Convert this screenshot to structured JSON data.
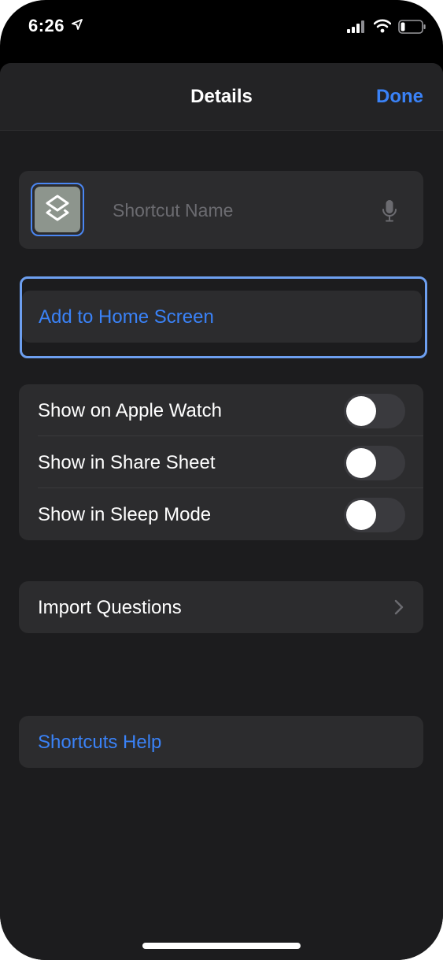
{
  "status_bar": {
    "time": "6:26"
  },
  "nav": {
    "title": "Details",
    "done_label": "Done"
  },
  "name_field": {
    "placeholder": "Shortcut Name",
    "value": ""
  },
  "add_to_home": {
    "label": "Add to Home Screen"
  },
  "toggles": [
    {
      "label": "Show on Apple Watch",
      "on": false
    },
    {
      "label": "Show in Share Sheet",
      "on": false
    },
    {
      "label": "Show in Sleep Mode",
      "on": false
    }
  ],
  "import_questions": {
    "label": "Import Questions"
  },
  "shortcuts_help": {
    "label": "Shortcuts Help"
  },
  "colors": {
    "accent": "#3a82f7",
    "sheet_background": "#1c1c1e",
    "card_background": "#2c2c2e",
    "switch_off": "#3a3a3e"
  },
  "icons": {
    "shortcut": "shortcuts-layers-icon",
    "mic": "microphone-icon",
    "chevron": "chevron-right-icon",
    "location": "location-arrow-icon",
    "signal": "cellular-signal-icon",
    "wifi": "wifi-icon",
    "battery": "battery-icon"
  }
}
